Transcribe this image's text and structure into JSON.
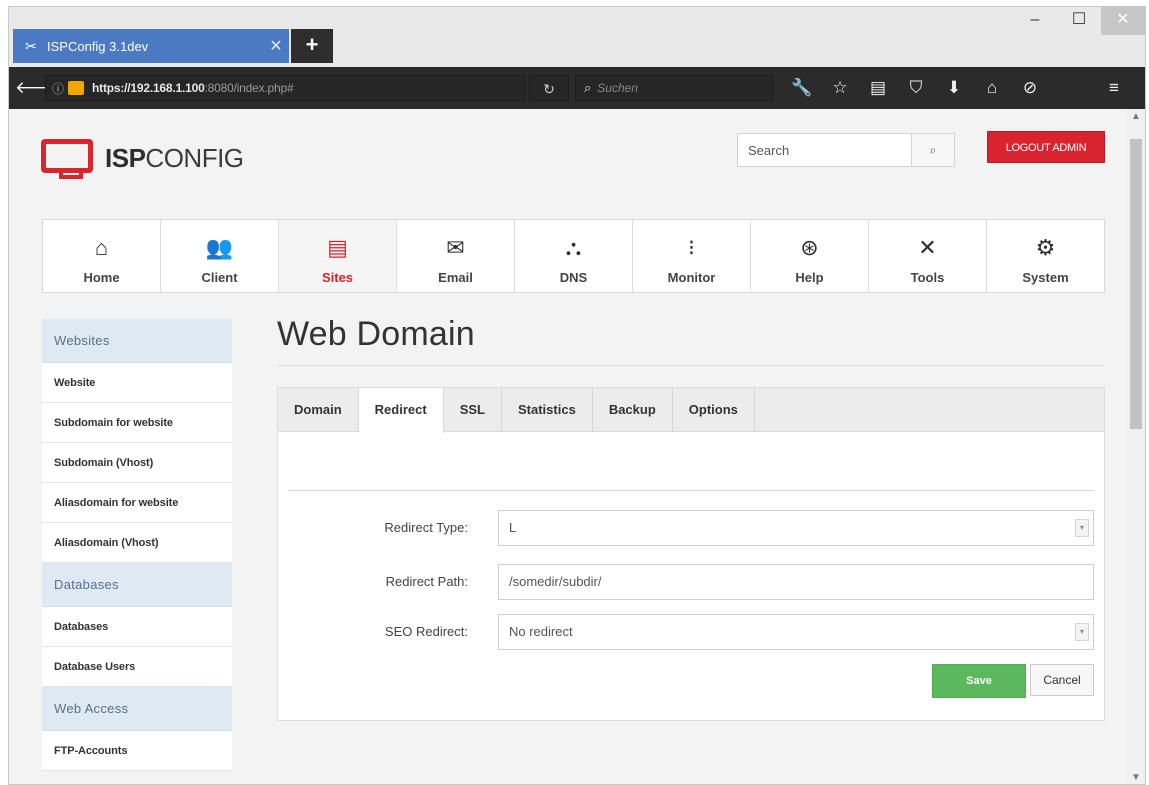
{
  "browser": {
    "tab_title": "ISPConfig 3.1dev",
    "tab_close": "✕",
    "new_tab": "+",
    "url_host": "https://192.168.1.100",
    "url_rest": ":8080/index.php#",
    "search_placeholder": "Suchen",
    "icons": [
      "back-icon",
      "info-icon",
      "lock-warning-icon",
      "reload-icon",
      "search-icon",
      "tools-icon",
      "bookmark-star-icon",
      "reading-list-icon",
      "pocket-icon",
      "download-icon",
      "home-icon",
      "addon-icon",
      "menu-icon"
    ]
  },
  "header": {
    "logo_bold": "ISP",
    "logo_light": "CONFIG",
    "search_placeholder": "Search",
    "logout_label": "LOGOUT ADMIN"
  },
  "mainnav": [
    {
      "label": "Home",
      "icon": "home-icon"
    },
    {
      "label": "Client",
      "icon": "users-icon"
    },
    {
      "label": "Sites",
      "icon": "sites-icon",
      "active": true
    },
    {
      "label": "Email",
      "icon": "email-icon"
    },
    {
      "label": "DNS",
      "icon": "dns-icon"
    },
    {
      "label": "Monitor",
      "icon": "monitor-icon"
    },
    {
      "label": "Help",
      "icon": "help-icon"
    },
    {
      "label": "Tools",
      "icon": "tools-icon"
    },
    {
      "label": "System",
      "icon": "gear-icon"
    }
  ],
  "sidebar": {
    "sections": [
      {
        "title": "Websites",
        "items": [
          "Website",
          "Subdomain for website",
          "Subdomain (Vhost)",
          "Aliasdomain for website",
          "Aliasdomain (Vhost)"
        ]
      },
      {
        "title": "Databases",
        "items": [
          "Databases",
          "Database Users"
        ]
      },
      {
        "title": "Web Access",
        "items": [
          "FTP-Accounts"
        ]
      }
    ]
  },
  "main": {
    "title": "Web Domain",
    "tabs": [
      "Domain",
      "Redirect",
      "SSL",
      "Statistics",
      "Backup",
      "Options"
    ],
    "active_tab": "Redirect",
    "form": {
      "redirect_type_label": "Redirect Type:",
      "redirect_type_value": "L",
      "redirect_path_label": "Redirect Path:",
      "redirect_path_value": "/somedir/subdir/",
      "seo_redirect_label": "SEO Redirect:",
      "seo_redirect_value": "No redirect"
    },
    "save_label": "Save",
    "cancel_label": "Cancel"
  },
  "colors": {
    "brand_red": "#d9232e",
    "save_green": "#5cb85c",
    "sidebar_header": "#dfe9f3",
    "tab_blue": "#4b79c2"
  }
}
